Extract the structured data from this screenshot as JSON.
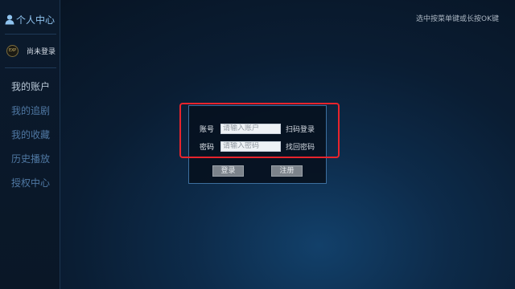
{
  "sidebar": {
    "title": "个人中心",
    "user": {
      "avatar_text": "EXP",
      "status": "尚未登录"
    },
    "items": [
      {
        "label": "我的账户",
        "active": true
      },
      {
        "label": "我的追剧",
        "active": false
      },
      {
        "label": "我的收藏",
        "active": false
      },
      {
        "label": "历史播放",
        "active": false
      },
      {
        "label": "授权中心",
        "active": false
      }
    ]
  },
  "hint": "选中按菜单键或长按OK键",
  "login": {
    "account_label": "账号",
    "account_placeholder": "请输入账户",
    "qr_login": "扫码登录",
    "password_label": "密码",
    "password_placeholder": "请输入密码",
    "forgot_password": "找回密码",
    "login_button": "登录",
    "register_button": "注册"
  },
  "colors": {
    "accent": "#8fc3ee",
    "menu_inactive": "#4f78a3",
    "highlight_border": "#e8242c",
    "dialog_border": "#3d6f9e"
  }
}
